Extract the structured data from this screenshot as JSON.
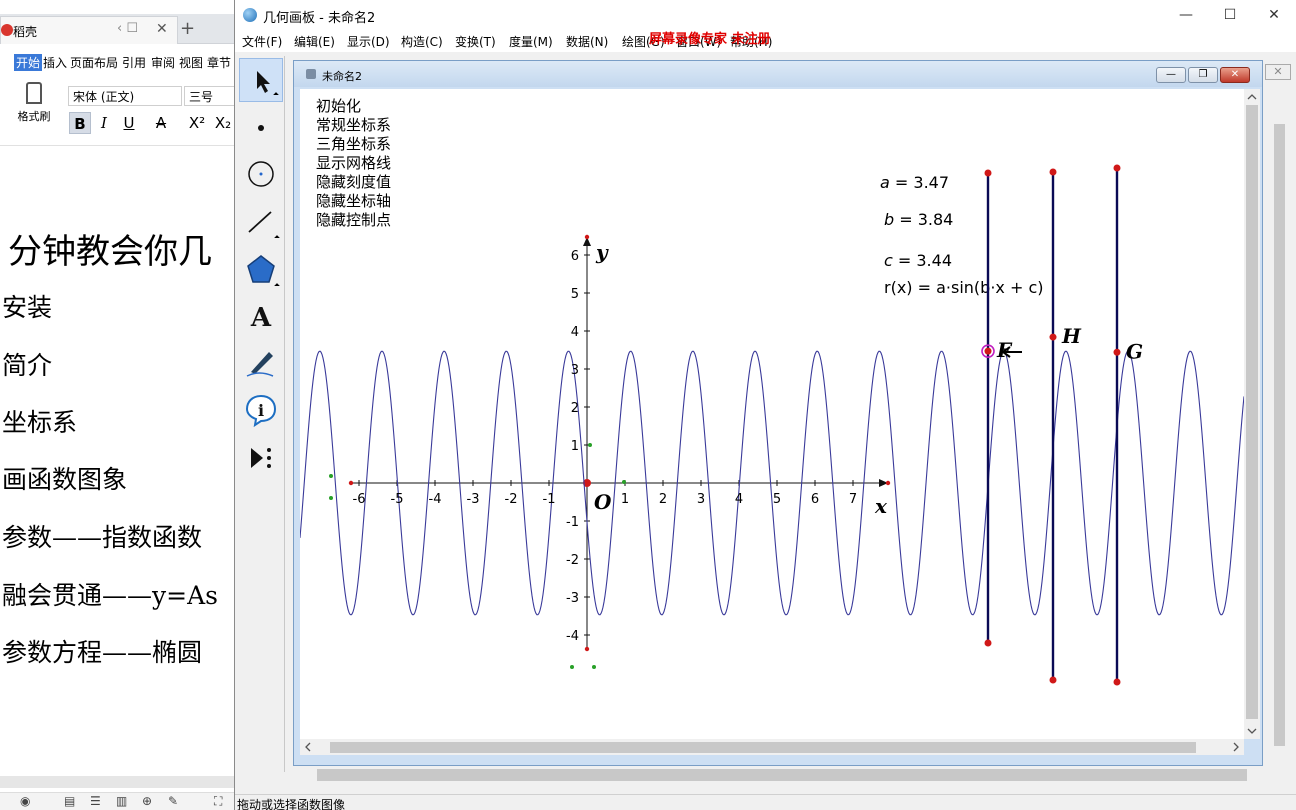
{
  "wps": {
    "tab_label": "稻壳",
    "menu": [
      "开始",
      "插入",
      "页面布局",
      "引用",
      "审阅",
      "视图",
      "章节"
    ],
    "format_brush": "格式刷",
    "font_name": "宋体 (正文)",
    "font_size": "三号",
    "doc_lines": [
      "分钟教会你几",
      "安装",
      "简介",
      "坐标系",
      "画函数图象",
      "参数——指数函数",
      "融会贯通——y=As",
      "参数方程——椭圆"
    ]
  },
  "gsp": {
    "window_title": "几何画板 - 未命名2",
    "menu": [
      "文件(F)",
      "编辑(E)",
      "显示(D)",
      "构造(C)",
      "变换(T)",
      "度量(M)",
      "数据(N)",
      "绘图(G)",
      "窗口(W)",
      "帮助(H)"
    ],
    "watermark": "屏幕录像专家 未注册",
    "document_title": "未命名2",
    "action_buttons": [
      "初始化",
      "常规坐标系",
      "三角坐标系",
      "显示网格线",
      "隐藏刻度值",
      "隐藏坐标轴",
      "隐藏控制点"
    ],
    "params": {
      "a_name": "a",
      "a_value": "3.47",
      "b_name": "b",
      "b_value": "3.84",
      "c_name": "c",
      "c_value": "3.44"
    },
    "function_name": "r(x)",
    "function_expr": "a·sin(b·x + c)",
    "axis_x_label": "x",
    "axis_y_label": "y",
    "origin_label": "O",
    "x_ticks": [
      "-6",
      "-5",
      "-4",
      "-3",
      "-2",
      "-1",
      "1",
      "2",
      "3",
      "4",
      "5",
      "6",
      "7"
    ],
    "y_ticks": [
      "-4",
      "-3",
      "-2",
      "-1",
      "1",
      "2",
      "3",
      "4",
      "5",
      "6"
    ],
    "point_labels": [
      "F",
      "H",
      "G"
    ],
    "status_text": "拖动或选择函数图像",
    "colors": {
      "curve": "#3a3a9a",
      "point": "#d01818",
      "slider": "#0a0a55",
      "selected": "#c020c0"
    }
  }
}
